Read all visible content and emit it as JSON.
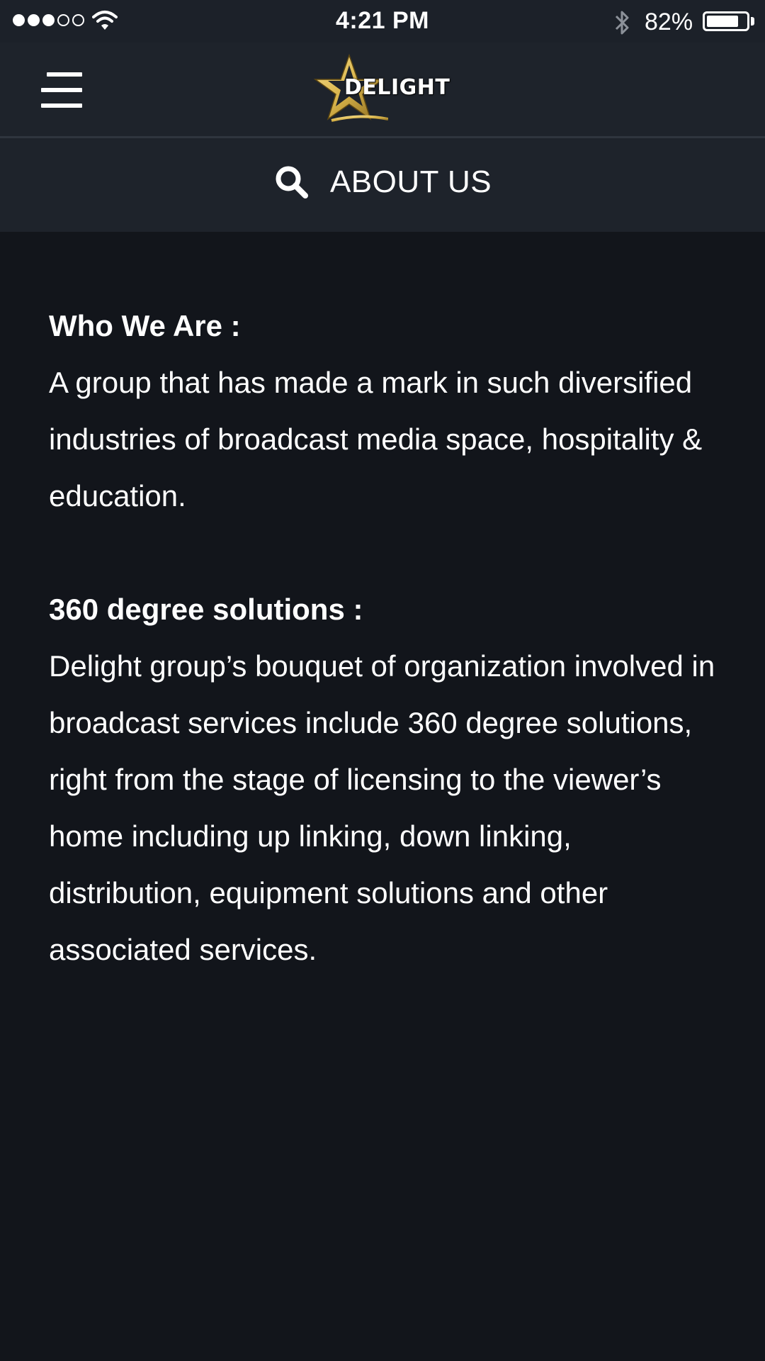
{
  "status_bar": {
    "time": "4:21 PM",
    "battery_percent_text": "82%",
    "battery_level": 0.82,
    "signal_bars_filled": 3,
    "signal_bars_total": 5,
    "icons": [
      "signal-icon",
      "wifi-icon",
      "bluetooth-icon",
      "battery-icon"
    ]
  },
  "navbar": {
    "menu_icon": "hamburger-menu-icon",
    "logo_text": "DELIGHT",
    "logo_star_color": "#d9b44a"
  },
  "subheader": {
    "search_icon": "search-icon",
    "title": "ABOUT US"
  },
  "content": {
    "sections": [
      {
        "heading": "Who We Are :",
        "body": "A group that has made a mark in such diversified industries of broadcast media space, hospitality & education."
      },
      {
        "heading": "360 degree solutions :",
        "body": "Delight group’s bouquet of organization involved in broadcast services include 360 degree solutions, right from the stage of licensing to the viewer’s home including up linking, down linking, distribution, equipment solutions and other associated services."
      }
    ]
  },
  "colors": {
    "background": "#12151b",
    "bar_background": "#1e232b",
    "text": "#ffffff",
    "accent_gold": "#d9b44a"
  }
}
